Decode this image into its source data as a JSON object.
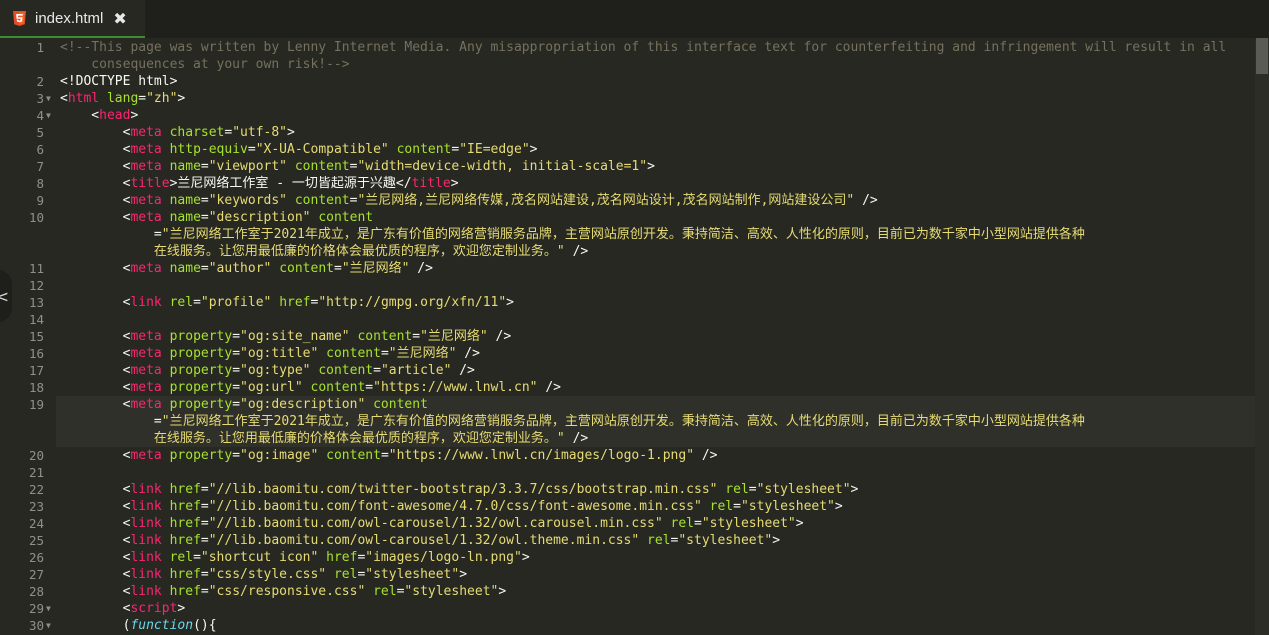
{
  "tab": {
    "icon": "html5-icon",
    "title": "index.html",
    "close_glyph": "✖"
  },
  "side_handle": {
    "icon": "chevron-left-icon",
    "glyph": "<"
  },
  "active_line": 19,
  "colors": {
    "background": "#272822",
    "tag": "#f92672",
    "attr": "#a6e22e",
    "string": "#e6db74",
    "comment": "#75715e",
    "tab_underline": "#3c8d2f"
  },
  "lines": [
    {
      "n": "1",
      "fold": false,
      "rows": [
        [
          [
            "c",
            "<!--This page was written by Lenny Internet Media. Any misappropriation of this interface text for counterfeiting and infringement will result in all"
          ]
        ],
        [
          [
            "c",
            "    consequences at your own risk!-->"
          ]
        ]
      ]
    },
    {
      "n": "2",
      "fold": false,
      "rows": [
        [
          [
            "p",
            "<!DOCTYPE html>"
          ]
        ]
      ]
    },
    {
      "n": "3",
      "fold": true,
      "rows": [
        [
          [
            "p",
            "<"
          ],
          [
            "t",
            "html"
          ],
          [
            "p",
            " "
          ],
          [
            "a",
            "lang"
          ],
          [
            "p",
            "="
          ],
          [
            "s",
            "\"zh\""
          ],
          [
            "p",
            ">"
          ]
        ]
      ]
    },
    {
      "n": "4",
      "fold": true,
      "rows": [
        [
          [
            "p",
            "    <"
          ],
          [
            "t",
            "head"
          ],
          [
            "p",
            ">"
          ]
        ]
      ]
    },
    {
      "n": "5",
      "fold": false,
      "rows": [
        [
          [
            "p",
            "        <"
          ],
          [
            "t",
            "meta"
          ],
          [
            "p",
            " "
          ],
          [
            "a",
            "charset"
          ],
          [
            "p",
            "="
          ],
          [
            "s",
            "\"utf-8\""
          ],
          [
            "p",
            ">"
          ]
        ]
      ]
    },
    {
      "n": "6",
      "fold": false,
      "rows": [
        [
          [
            "p",
            "        <"
          ],
          [
            "t",
            "meta"
          ],
          [
            "p",
            " "
          ],
          [
            "a",
            "http-equiv"
          ],
          [
            "p",
            "="
          ],
          [
            "s",
            "\"X-UA-Compatible\""
          ],
          [
            "p",
            " "
          ],
          [
            "a",
            "content"
          ],
          [
            "p",
            "="
          ],
          [
            "s",
            "\"IE=edge\""
          ],
          [
            "p",
            ">"
          ]
        ]
      ]
    },
    {
      "n": "7",
      "fold": false,
      "rows": [
        [
          [
            "p",
            "        <"
          ],
          [
            "t",
            "meta"
          ],
          [
            "p",
            " "
          ],
          [
            "a",
            "name"
          ],
          [
            "p",
            "="
          ],
          [
            "s",
            "\"viewport\""
          ],
          [
            "p",
            " "
          ],
          [
            "a",
            "content"
          ],
          [
            "p",
            "="
          ],
          [
            "s",
            "\"width=device-width, initial-scale=1\""
          ],
          [
            "p",
            ">"
          ]
        ]
      ]
    },
    {
      "n": "8",
      "fold": false,
      "rows": [
        [
          [
            "p",
            "        <"
          ],
          [
            "t",
            "title"
          ],
          [
            "p",
            ">兰尼网络工作室 - 一切皆起源于兴趣</"
          ],
          [
            "t",
            "title"
          ],
          [
            "p",
            ">"
          ]
        ]
      ]
    },
    {
      "n": "9",
      "fold": false,
      "rows": [
        [
          [
            "p",
            "        <"
          ],
          [
            "t",
            "meta"
          ],
          [
            "p",
            " "
          ],
          [
            "a",
            "name"
          ],
          [
            "p",
            "="
          ],
          [
            "s",
            "\"keywords\""
          ],
          [
            "p",
            " "
          ],
          [
            "a",
            "content"
          ],
          [
            "p",
            "="
          ],
          [
            "s",
            "\"兰尼网络,兰尼网络传媒,茂名网站建设,茂名网站设计,茂名网站制作,网站建设公司\""
          ],
          [
            "p",
            " />"
          ]
        ]
      ]
    },
    {
      "n": "10",
      "fold": false,
      "rows": [
        [
          [
            "p",
            "        <"
          ],
          [
            "t",
            "meta"
          ],
          [
            "p",
            " "
          ],
          [
            "a",
            "name"
          ],
          [
            "p",
            "="
          ],
          [
            "s",
            "\"description\""
          ],
          [
            "p",
            " "
          ],
          [
            "a",
            "content"
          ]
        ],
        [
          [
            "p",
            "            ="
          ],
          [
            "s",
            "\"兰尼网络工作室于2021年成立，是广东有价值的网络营销服务品牌，主营网站原创开发。秉持简洁、高效、人性化的原则，目前已为数千家中小型网站提供各种"
          ]
        ],
        [
          [
            "s",
            "            在线服务。让您用最低廉的价格体会最优质的程序，欢迎您定制业务。\""
          ],
          [
            "p",
            " />"
          ]
        ]
      ]
    },
    {
      "n": "11",
      "fold": false,
      "rows": [
        [
          [
            "p",
            "        <"
          ],
          [
            "t",
            "meta"
          ],
          [
            "p",
            " "
          ],
          [
            "a",
            "name"
          ],
          [
            "p",
            "="
          ],
          [
            "s",
            "\"author\""
          ],
          [
            "p",
            " "
          ],
          [
            "a",
            "content"
          ],
          [
            "p",
            "="
          ],
          [
            "s",
            "\"兰尼网络\""
          ],
          [
            "p",
            " />"
          ]
        ]
      ]
    },
    {
      "n": "12",
      "fold": false,
      "rows": [
        []
      ]
    },
    {
      "n": "13",
      "fold": false,
      "rows": [
        [
          [
            "p",
            "        <"
          ],
          [
            "t",
            "link"
          ],
          [
            "p",
            " "
          ],
          [
            "a",
            "rel"
          ],
          [
            "p",
            "="
          ],
          [
            "s",
            "\"profile\""
          ],
          [
            "p",
            " "
          ],
          [
            "a",
            "href"
          ],
          [
            "p",
            "="
          ],
          [
            "s",
            "\"http://gmpg.org/xfn/11\""
          ],
          [
            "p",
            ">"
          ]
        ]
      ]
    },
    {
      "n": "14",
      "fold": false,
      "rows": [
        []
      ]
    },
    {
      "n": "15",
      "fold": false,
      "rows": [
        [
          [
            "p",
            "        <"
          ],
          [
            "t",
            "meta"
          ],
          [
            "p",
            " "
          ],
          [
            "a",
            "property"
          ],
          [
            "p",
            "="
          ],
          [
            "s",
            "\"og:site_name\""
          ],
          [
            "p",
            " "
          ],
          [
            "a",
            "content"
          ],
          [
            "p",
            "="
          ],
          [
            "s",
            "\"兰尼网络\""
          ],
          [
            "p",
            " />"
          ]
        ]
      ]
    },
    {
      "n": "16",
      "fold": false,
      "rows": [
        [
          [
            "p",
            "        <"
          ],
          [
            "t",
            "meta"
          ],
          [
            "p",
            " "
          ],
          [
            "a",
            "property"
          ],
          [
            "p",
            "="
          ],
          [
            "s",
            "\"og:title\""
          ],
          [
            "p",
            " "
          ],
          [
            "a",
            "content"
          ],
          [
            "p",
            "="
          ],
          [
            "s",
            "\"兰尼网络\""
          ],
          [
            "p",
            " />"
          ]
        ]
      ]
    },
    {
      "n": "17",
      "fold": false,
      "rows": [
        [
          [
            "p",
            "        <"
          ],
          [
            "t",
            "meta"
          ],
          [
            "p",
            " "
          ],
          [
            "a",
            "property"
          ],
          [
            "p",
            "="
          ],
          [
            "s",
            "\"og:type\""
          ],
          [
            "p",
            " "
          ],
          [
            "a",
            "content"
          ],
          [
            "p",
            "="
          ],
          [
            "s",
            "\"article\""
          ],
          [
            "p",
            " />"
          ]
        ]
      ]
    },
    {
      "n": "18",
      "fold": false,
      "rows": [
        [
          [
            "p",
            "        <"
          ],
          [
            "t",
            "meta"
          ],
          [
            "p",
            " "
          ],
          [
            "a",
            "property"
          ],
          [
            "p",
            "="
          ],
          [
            "s",
            "\"og:url\""
          ],
          [
            "p",
            " "
          ],
          [
            "a",
            "content"
          ],
          [
            "p",
            "="
          ],
          [
            "s",
            "\"https://www.lnwl.cn\""
          ],
          [
            "p",
            " />"
          ]
        ]
      ]
    },
    {
      "n": "19",
      "fold": false,
      "rows": [
        [
          [
            "p",
            "        <"
          ],
          [
            "t",
            "meta"
          ],
          [
            "p",
            " "
          ],
          [
            "a",
            "property"
          ],
          [
            "p",
            "="
          ],
          [
            "s",
            "\"og:description\""
          ],
          [
            "p",
            " "
          ],
          [
            "a",
            "content"
          ]
        ],
        [
          [
            "p",
            "            ="
          ],
          [
            "s",
            "\"兰尼网络工作室于2021年成立，是广东有价值的网络营销服务品牌，主营网站原创开发。秉持简洁、高效、人性化的原则，目前已为数千家中小型网站提供各种"
          ]
        ],
        [
          [
            "s",
            "            在线服务。让您用最低廉的价格体会最优质的程序，欢迎您定制业务。\""
          ],
          [
            "p",
            " />"
          ]
        ]
      ]
    },
    {
      "n": "20",
      "fold": false,
      "rows": [
        [
          [
            "p",
            "        <"
          ],
          [
            "t",
            "meta"
          ],
          [
            "p",
            " "
          ],
          [
            "a",
            "property"
          ],
          [
            "p",
            "="
          ],
          [
            "s",
            "\"og:image\""
          ],
          [
            "p",
            " "
          ],
          [
            "a",
            "content"
          ],
          [
            "p",
            "="
          ],
          [
            "s",
            "\"https://www.lnwl.cn/images/logo-1.png\""
          ],
          [
            "p",
            " />"
          ]
        ]
      ]
    },
    {
      "n": "21",
      "fold": false,
      "rows": [
        []
      ]
    },
    {
      "n": "22",
      "fold": false,
      "rows": [
        [
          [
            "p",
            "        <"
          ],
          [
            "t",
            "link"
          ],
          [
            "p",
            " "
          ],
          [
            "a",
            "href"
          ],
          [
            "p",
            "="
          ],
          [
            "s",
            "\"//lib.baomitu.com/twitter-bootstrap/3.3.7/css/bootstrap.min.css\""
          ],
          [
            "p",
            " "
          ],
          [
            "a",
            "rel"
          ],
          [
            "p",
            "="
          ],
          [
            "s",
            "\"stylesheet\""
          ],
          [
            "p",
            ">"
          ]
        ]
      ]
    },
    {
      "n": "23",
      "fold": false,
      "rows": [
        [
          [
            "p",
            "        <"
          ],
          [
            "t",
            "link"
          ],
          [
            "p",
            " "
          ],
          [
            "a",
            "href"
          ],
          [
            "p",
            "="
          ],
          [
            "s",
            "\"//lib.baomitu.com/font-awesome/4.7.0/css/font-awesome.min.css\""
          ],
          [
            "p",
            " "
          ],
          [
            "a",
            "rel"
          ],
          [
            "p",
            "="
          ],
          [
            "s",
            "\"stylesheet\""
          ],
          [
            "p",
            ">"
          ]
        ]
      ]
    },
    {
      "n": "24",
      "fold": false,
      "rows": [
        [
          [
            "p",
            "        <"
          ],
          [
            "t",
            "link"
          ],
          [
            "p",
            " "
          ],
          [
            "a",
            "href"
          ],
          [
            "p",
            "="
          ],
          [
            "s",
            "\"//lib.baomitu.com/owl-carousel/1.32/owl.carousel.min.css\""
          ],
          [
            "p",
            " "
          ],
          [
            "a",
            "rel"
          ],
          [
            "p",
            "="
          ],
          [
            "s",
            "\"stylesheet\""
          ],
          [
            "p",
            ">"
          ]
        ]
      ]
    },
    {
      "n": "25",
      "fold": false,
      "rows": [
        [
          [
            "p",
            "        <"
          ],
          [
            "t",
            "link"
          ],
          [
            "p",
            " "
          ],
          [
            "a",
            "href"
          ],
          [
            "p",
            "="
          ],
          [
            "s",
            "\"//lib.baomitu.com/owl-carousel/1.32/owl.theme.min.css\""
          ],
          [
            "p",
            " "
          ],
          [
            "a",
            "rel"
          ],
          [
            "p",
            "="
          ],
          [
            "s",
            "\"stylesheet\""
          ],
          [
            "p",
            ">"
          ]
        ]
      ]
    },
    {
      "n": "26",
      "fold": false,
      "rows": [
        [
          [
            "p",
            "        <"
          ],
          [
            "t",
            "link"
          ],
          [
            "p",
            " "
          ],
          [
            "a",
            "rel"
          ],
          [
            "p",
            "="
          ],
          [
            "s",
            "\"shortcut icon\""
          ],
          [
            "p",
            " "
          ],
          [
            "a",
            "href"
          ],
          [
            "p",
            "="
          ],
          [
            "s",
            "\"images/logo-ln.png\""
          ],
          [
            "p",
            ">"
          ]
        ]
      ]
    },
    {
      "n": "27",
      "fold": false,
      "rows": [
        [
          [
            "p",
            "        <"
          ],
          [
            "t",
            "link"
          ],
          [
            "p",
            " "
          ],
          [
            "a",
            "href"
          ],
          [
            "p",
            "="
          ],
          [
            "s",
            "\"css/style.css\""
          ],
          [
            "p",
            " "
          ],
          [
            "a",
            "rel"
          ],
          [
            "p",
            "="
          ],
          [
            "s",
            "\"stylesheet\""
          ],
          [
            "p",
            ">"
          ]
        ]
      ]
    },
    {
      "n": "28",
      "fold": false,
      "rows": [
        [
          [
            "p",
            "        <"
          ],
          [
            "t",
            "link"
          ],
          [
            "p",
            " "
          ],
          [
            "a",
            "href"
          ],
          [
            "p",
            "="
          ],
          [
            "s",
            "\"css/responsive.css\""
          ],
          [
            "p",
            " "
          ],
          [
            "a",
            "rel"
          ],
          [
            "p",
            "="
          ],
          [
            "s",
            "\"stylesheet\""
          ],
          [
            "p",
            ">"
          ]
        ]
      ]
    },
    {
      "n": "29",
      "fold": true,
      "rows": [
        [
          [
            "p",
            "        <"
          ],
          [
            "t",
            "script"
          ],
          [
            "p",
            ">"
          ]
        ]
      ]
    },
    {
      "n": "30",
      "fold": true,
      "rows": [
        [
          [
            "p",
            "        ("
          ],
          [
            "k",
            "function"
          ],
          [
            "p",
            "(){"
          ]
        ]
      ]
    }
  ]
}
